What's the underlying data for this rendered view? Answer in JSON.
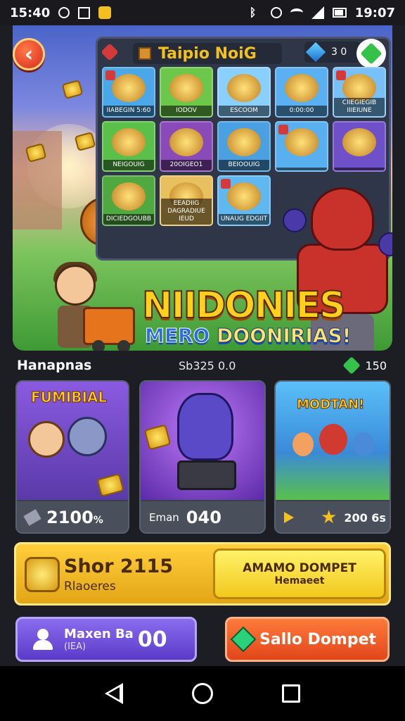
{
  "status_bar": {
    "time": "15:40",
    "battery": "19:07"
  },
  "shop": {
    "title": "Taipio NoiG",
    "gem_count": "3 0",
    "items": [
      {
        "label": "IIABEGIN 5:60",
        "bg": "#4aa8e8"
      },
      {
        "label": "IODOV",
        "bg": "#6cc84a"
      },
      {
        "label": "ESCOOM",
        "bg": "#8ad0ff"
      },
      {
        "label": "0:00:00",
        "bg": "#5ab0f0"
      },
      {
        "label": "CIIEGIEGIB IIIEIUNE",
        "bg": "#78c0f8"
      },
      {
        "label": "NEIGOUIG",
        "bg": "#5ac04a"
      },
      {
        "label": "20OIGEO1",
        "bg": "#8a4ab8"
      },
      {
        "label": "BEIOOUIG",
        "bg": "#4aa0e0"
      },
      {
        "label": "",
        "bg": "#58b0f0"
      },
      {
        "label": "",
        "bg": "#7050c8"
      },
      {
        "label": "DICIEDGOUBB",
        "bg": "#50a840"
      },
      {
        "label": "EEADIIG DAGRADIUE IEUD",
        "bg": "#e8c060"
      },
      {
        "label": "UNAUG EDGIIT",
        "bg": "#60b8f0"
      }
    ]
  },
  "logo": {
    "title": "NIIDONIES",
    "sub_a": "MERO",
    "sub_b": "DOONIRIAS!"
  },
  "section": {
    "title": "Hanapnas",
    "middle": "Sb325 0.0",
    "gems": "150"
  },
  "cards": [
    {
      "title": "FUMIBIAL",
      "value": "2100",
      "suffix": "%",
      "bg": "#6a48c0"
    },
    {
      "title": "",
      "prefix": "Eman",
      "value": "040",
      "bg": "#7a3ad0"
    },
    {
      "title": "MODTAN!",
      "value": "200 6s",
      "bg": "#3aa0e8"
    }
  ],
  "banner": {
    "title": "Shor 2115",
    "subtitle": "Rlaoeres",
    "button_line1": "AMAMO DOMPET",
    "button_line2": "Hemaeet"
  },
  "buttons": {
    "left_title": "Maxen Ba",
    "left_sub": "(IEA)",
    "left_value": "00",
    "right_label": "Sallo Dompet"
  },
  "colors": {
    "accent": "#f2c01f",
    "gem_green": "#34c24a",
    "purple": "#6a4ad8",
    "orange": "#f05a22"
  }
}
